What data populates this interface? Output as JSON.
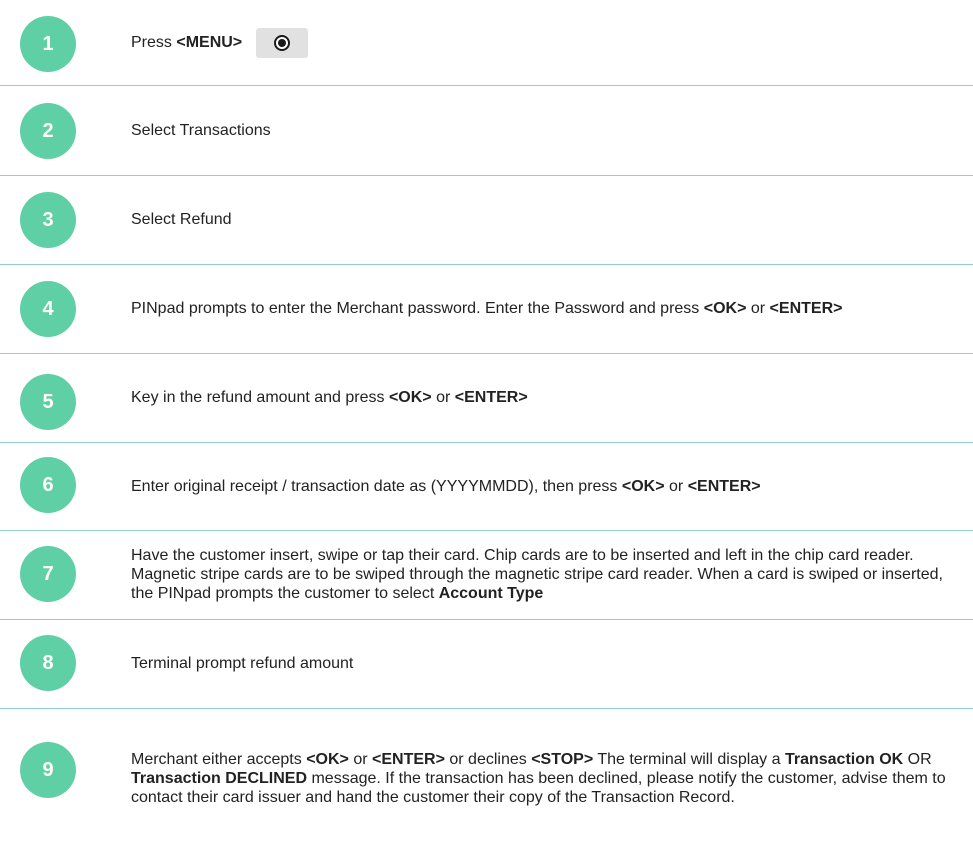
{
  "accent": "#5fcfa6",
  "divider_color": "#8fd1cb",
  "steps": [
    {
      "number": "1",
      "runs": [
        {
          "t": "Press "
        },
        {
          "b": "<MENU>"
        }
      ],
      "icon": "menu-button-icon"
    },
    {
      "number": "2",
      "runs": [
        {
          "t": "Select Transactions"
        }
      ]
    },
    {
      "number": "3",
      "runs": [
        {
          "t": "Select Refund"
        }
      ]
    },
    {
      "number": "4",
      "runs": [
        {
          "t": "PINpad prompts to enter the Merchant password. Enter the Password and press "
        },
        {
          "b": "<OK>"
        },
        {
          "t": " or "
        },
        {
          "b": "<ENTER>"
        }
      ]
    },
    {
      "number": "5",
      "runs": [
        {
          "t": "Key in the refund amount and press "
        },
        {
          "b": "<OK>"
        },
        {
          "t": " or "
        },
        {
          "b": "<ENTER>"
        }
      ]
    },
    {
      "number": "6",
      "runs": [
        {
          "t": "Enter original receipt / transaction date as (YYYYMMDD), then press "
        },
        {
          "b": "<OK>"
        },
        {
          "t": " or "
        },
        {
          "b": "<ENTER>"
        }
      ]
    },
    {
      "number": "7",
      "runs": [
        {
          "t": "Have the customer insert, swipe or tap their card. Chip cards are to be inserted and left in the chip card reader. Magnetic stripe cards are to be swiped through the magnetic stripe card reader. When a card is swiped or inserted, the PINpad prompts the customer to select "
        },
        {
          "b": "Account Type"
        }
      ]
    },
    {
      "number": "8",
      "runs": [
        {
          "t": "Terminal prompt refund amount"
        }
      ]
    },
    {
      "number": "9",
      "runs": [
        {
          "t": "Merchant either accepts "
        },
        {
          "b": "<OK>"
        },
        {
          "t": " or "
        },
        {
          "b": "<ENTER>"
        },
        {
          "t": " or declines "
        },
        {
          "b": "<STOP>"
        },
        {
          "t": " The terminal will display a "
        },
        {
          "b": "Transaction OK"
        },
        {
          "t": " OR "
        },
        {
          "b": "Transaction DECLINED"
        },
        {
          "t": " message. If the transaction has been declined, please notify the customer, advise them to contact their card issuer and hand the customer their copy of the Transaction Record."
        }
      ]
    }
  ]
}
